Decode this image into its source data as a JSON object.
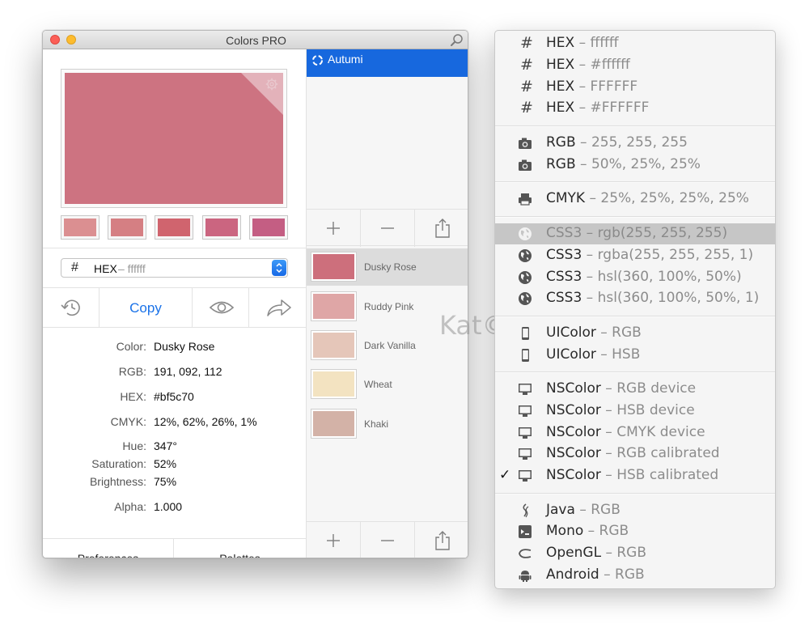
{
  "window": {
    "title": "Colors PRO"
  },
  "current_color": {
    "hex": "#bf5c70",
    "preview": "#cd7381"
  },
  "swatches": [
    "#db8f91",
    "#d57f83",
    "#d0646e",
    "#cb6580",
    "#c45e83"
  ],
  "format": {
    "hash": "#",
    "name": "HEX",
    "example": "– ffffff"
  },
  "actions": {
    "copy_label": "Copy"
  },
  "info": {
    "color_key": "Color:",
    "color_val": "Dusky Rose",
    "rgb_key": "RGB:",
    "rgb_val": "191, 092, 112",
    "hex_key": "HEX:",
    "hex_val": "#bf5c70",
    "cmyk_key": "CMYK:",
    "cmyk_val": "12%, 62%, 26%, 1%",
    "hue_key": "Hue:",
    "hue_val": "347°",
    "sat_key": "Saturation:",
    "sat_val": "52%",
    "bright_key": "Brightness:",
    "bright_val": "75%",
    "alpha_key": "Alpha:",
    "alpha_val": "1.000"
  },
  "bottom": {
    "preferences": "Preferences",
    "palettes": "Palettes"
  },
  "palettes": {
    "selected": "Autumi"
  },
  "palette_colors": [
    {
      "name": "Dusky Rose",
      "color": "#cd6f7c"
    },
    {
      "name": "Ruddy Pink",
      "color": "#dfa6a6"
    },
    {
      "name": "Dark Vanilla",
      "color": "#e5c6b9"
    },
    {
      "name": "Wheat",
      "color": "#f3e3c1"
    },
    {
      "name": "Khaki",
      "color": "#d3b2a7"
    }
  ],
  "watermark": "Kat©",
  "menu": {
    "hex": [
      {
        "name": "HEX",
        "detail": " – ffffff"
      },
      {
        "name": "HEX",
        "detail": " – #ffffff"
      },
      {
        "name": "HEX",
        "detail": " – FFFFFF"
      },
      {
        "name": "HEX",
        "detail": " – #FFFFFF"
      }
    ],
    "rgb": [
      {
        "name": "RGB",
        "detail": " – 255, 255, 255"
      },
      {
        "name": "RGB",
        "detail": " – 50%, 25%, 25%"
      }
    ],
    "cmyk": [
      {
        "name": "CMYK",
        "detail": " – 25%, 25%, 25%, 25%"
      }
    ],
    "css": [
      {
        "name": "CSS3",
        "detail": " – rgb(255, 255, 255)"
      },
      {
        "name": "CSS3",
        "detail": " – rgba(255, 255, 255, 1)"
      },
      {
        "name": "CSS3",
        "detail": " – hsl(360, 100%, 50%)"
      },
      {
        "name": "CSS3",
        "detail": " – hsl(360, 100%, 50%, 1)"
      }
    ],
    "uicolor": [
      {
        "name": "UIColor",
        "detail": " – RGB"
      },
      {
        "name": "UIColor",
        "detail": " – HSB"
      }
    ],
    "nscolor": [
      {
        "name": "NSColor",
        "detail": " – RGB device"
      },
      {
        "name": "NSColor",
        "detail": " – HSB device"
      },
      {
        "name": "NSColor",
        "detail": " – CMYK device"
      },
      {
        "name": "NSColor",
        "detail": " – RGB calibrated"
      },
      {
        "name": "NSColor",
        "detail": " – HSB calibrated"
      }
    ],
    "checkmark": "✓",
    "other": [
      {
        "name": "Java",
        "detail": " – RGB"
      },
      {
        "name": "Mono",
        "detail": " – RGB"
      },
      {
        "name": "OpenGL",
        "detail": " – RGB"
      },
      {
        "name": "Android",
        "detail": " – RGB"
      }
    ]
  }
}
